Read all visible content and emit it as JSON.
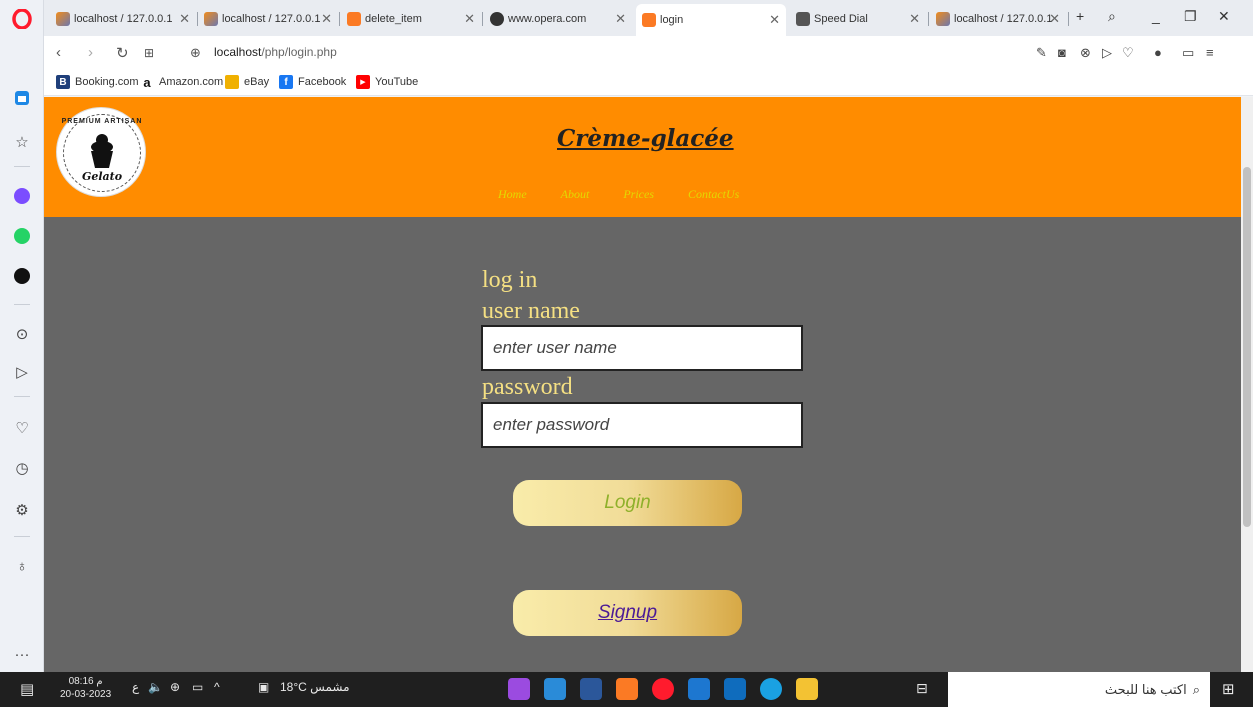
{
  "browser": {
    "tabs": [
      {
        "label": "localhost / 127.0.0.1",
        "favicon": "phpmyadmin-icon"
      },
      {
        "label": "localhost / 127.0.0.1",
        "favicon": "phpmyadmin-icon"
      },
      {
        "label": "delete_item",
        "favicon": "xampp-icon"
      },
      {
        "label": "www.opera.com",
        "favicon": "globe-icon"
      },
      {
        "label": "login",
        "favicon": "xampp-icon",
        "active": true
      },
      {
        "label": "Speed Dial",
        "favicon": "speed-dial-icon"
      },
      {
        "label": "localhost / 127.0.0.1",
        "favicon": "phpmyadmin-icon"
      }
    ],
    "url_host": "localhost",
    "url_path": "/php/login.php",
    "bookmarks": [
      {
        "label": "Booking.com",
        "badge": "B",
        "color": "#1f3f7a"
      },
      {
        "label": "Amazon.com",
        "badge": "a",
        "color": "#222222"
      },
      {
        "label": "eBay",
        "badge": "",
        "color": "#f0b000"
      },
      {
        "label": "Facebook",
        "badge": "f",
        "color": "#1877f2"
      },
      {
        "label": "YouTube",
        "badge": "▶",
        "color": "#ff0000"
      }
    ]
  },
  "site": {
    "title": "Crème-glacée",
    "logo": {
      "arc_text": "PREMIUM ARTISAN",
      "script_text": "Gelato"
    },
    "menu": [
      "Home",
      "About",
      "Prices",
      "ContactUs"
    ]
  },
  "form": {
    "heading": "log in",
    "username_label": "user name",
    "username_placeholder": "enter user name",
    "password_label": "password",
    "password_placeholder": "enter password",
    "login_label": "Login",
    "signup_label": "Signup"
  },
  "taskbar": {
    "time": "08:16 م",
    "date": "20-03-2023",
    "lang": "ع",
    "weather": "18°C مشمس",
    "search_placeholder": "اكتب هنا للبحث"
  },
  "colors": {
    "header": "#ff8c00",
    "page_bg": "#666666",
    "label_text": "#f5e083",
    "menu_text": "#e3d900"
  }
}
